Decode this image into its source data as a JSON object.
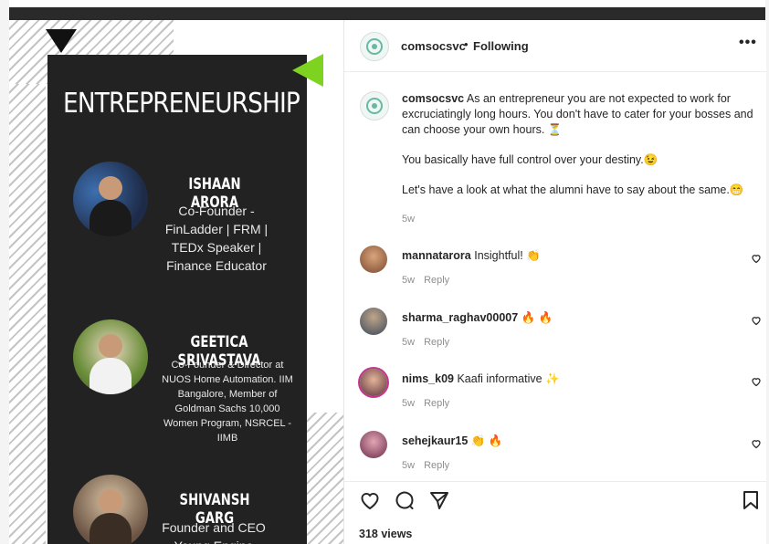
{
  "post_image": {
    "title": "ENTREPRENEURSHIP",
    "people": [
      {
        "name": "ISHAAN ARORA",
        "role_lines": [
          "Co-Founder -",
          "FinLadder | FRM |",
          "TEDx Speaker |",
          "Finance Educator"
        ]
      },
      {
        "name": "GEETICA SRIVASTAVA",
        "role_lines": [
          "Co-Founder & Director at",
          "NUOS Home Automation. IIM",
          "Bangalore, Member of",
          "Goldman Sachs 10,000",
          "Women Program, NSRCEL -",
          "IIMB"
        ]
      },
      {
        "name": "SHIVANSH GARG",
        "role_lines": [
          "Founder and CEO",
          "Young Engine"
        ]
      }
    ],
    "colors": {
      "card": "#222222",
      "accent_triangle": "#7ed321"
    }
  },
  "header": {
    "username": "comsocsvc",
    "separator": "•",
    "follow_status": "Following",
    "more_icon": "more-horizontal-icon"
  },
  "caption": {
    "username": "comsocsvc",
    "paragraphs": [
      "As an entrepreneur you are not expected to work for excruciatingly long hours. You don't have to cater for your bosses and can choose your own hours. ⏳",
      "You basically have full control over your destiny.😉",
      "Let's have a look at what the alumni have to say about the same.😁"
    ],
    "time": "5w"
  },
  "comments": [
    {
      "username": "mannatarora",
      "text": "Insightful! 👏",
      "time": "5w",
      "reply": "Reply"
    },
    {
      "username": "sharma_raghav00007",
      "text": "🔥 🔥",
      "time": "5w",
      "reply": "Reply"
    },
    {
      "username": "nims_k09",
      "text": "Kaafi informative ✨",
      "time": "5w",
      "reply": "Reply"
    },
    {
      "username": "sehejkaur15",
      "text": "👏 🔥",
      "time": "5w",
      "reply": "Reply"
    }
  ],
  "actions": {
    "like_icon": "heart-icon",
    "comment_icon": "comment-icon",
    "share_icon": "send-icon",
    "save_icon": "bookmark-icon"
  },
  "views": "318 views"
}
